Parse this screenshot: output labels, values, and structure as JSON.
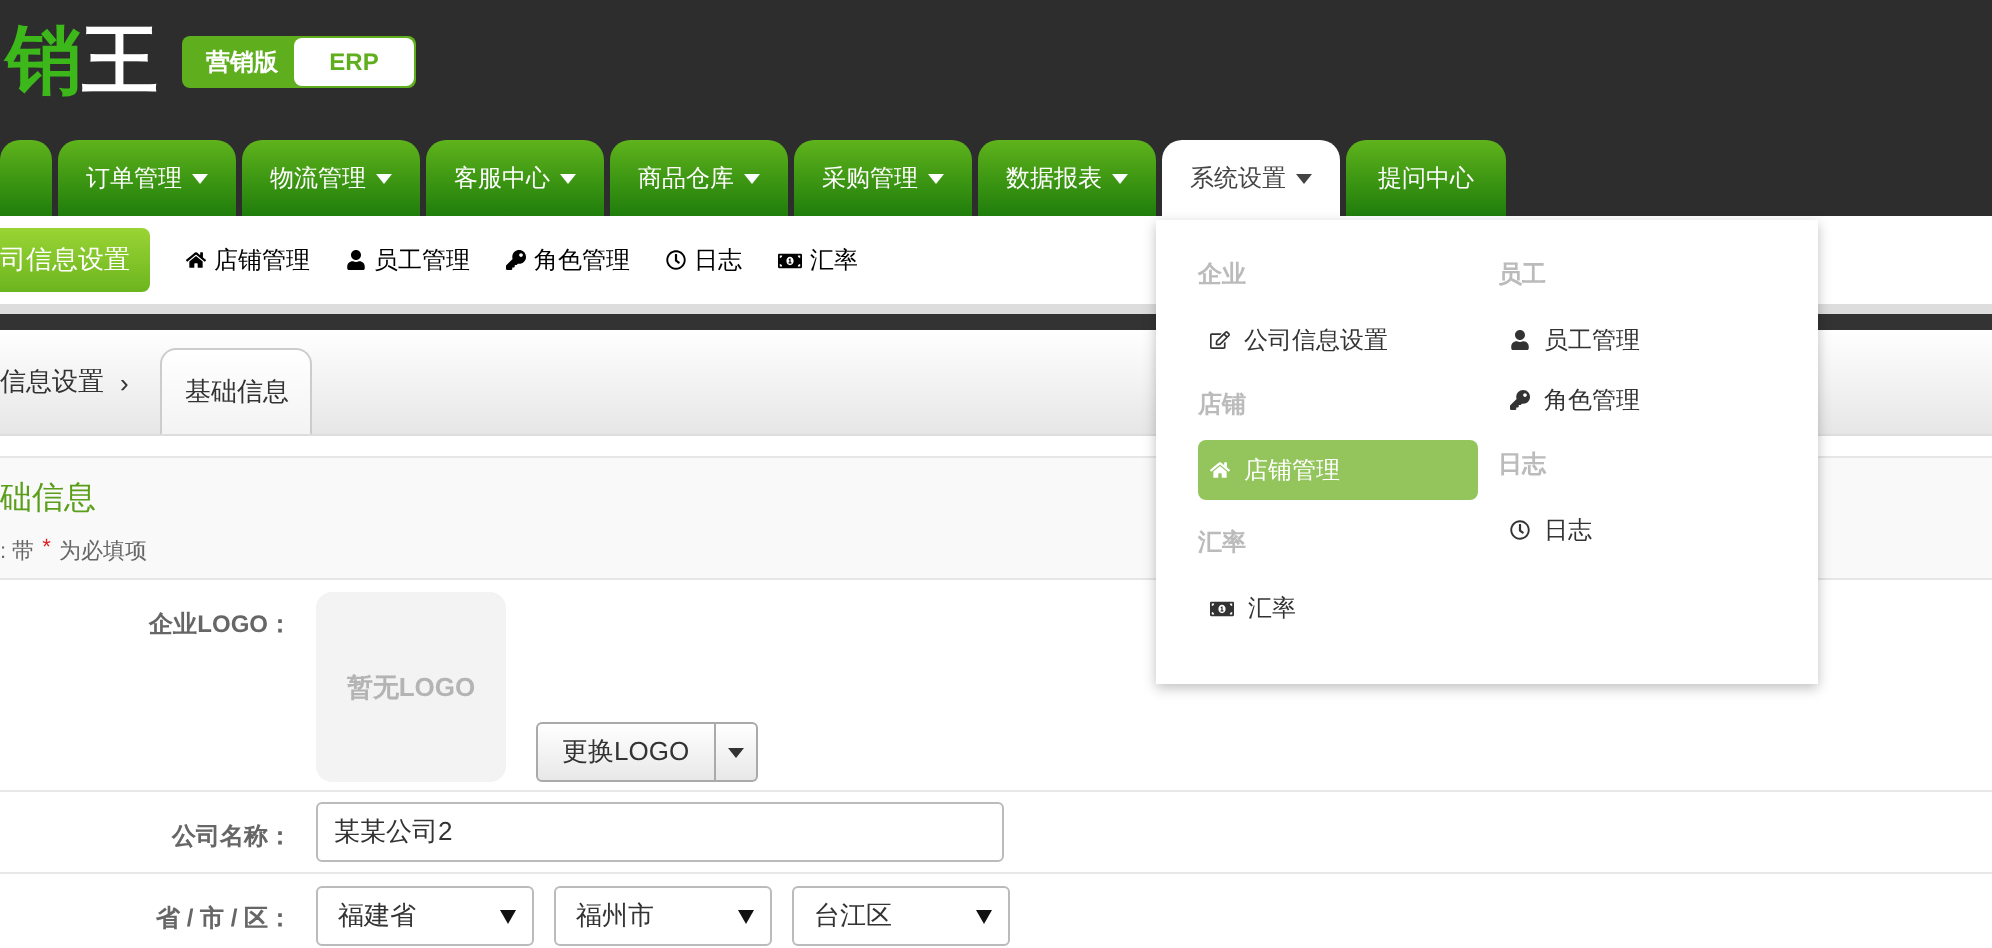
{
  "brand": {
    "accent": "销",
    "rest": "王",
    "edition": "营销版",
    "product": "ERP"
  },
  "nav_tabs": [
    {
      "has_caret": false,
      "selected": false
    },
    {
      "label": "订单管理",
      "has_caret": true,
      "selected": false
    },
    {
      "label": "物流管理",
      "has_caret": true,
      "selected": false
    },
    {
      "label": "客服中心",
      "has_caret": true,
      "selected": false
    },
    {
      "label": "商品仓库",
      "has_caret": true,
      "selected": false
    },
    {
      "label": "采购管理",
      "has_caret": true,
      "selected": false
    },
    {
      "label": "数据报表",
      "has_caret": true,
      "selected": false
    },
    {
      "label": "系统设置",
      "has_caret": true,
      "selected": true
    },
    {
      "label": "提问中心",
      "has_caret": false,
      "selected": false
    }
  ],
  "sub_nav": [
    {
      "label": "司信息设置",
      "kind": "plain",
      "selected": true
    },
    {
      "label": "店铺管理",
      "kind": "home",
      "selected": false
    },
    {
      "label": "员工管理",
      "kind": "user",
      "selected": false
    },
    {
      "label": "角色管理",
      "kind": "key",
      "selected": false
    },
    {
      "label": "日志",
      "kind": "clock",
      "selected": false
    },
    {
      "label": "汇率",
      "kind": "money",
      "selected": false
    }
  ],
  "breadcrumb": {
    "parent": "信息设置",
    "separator": "›",
    "tabs": [
      {
        "label": "基础信息",
        "selected": true
      }
    ]
  },
  "section": {
    "title": "础信息",
    "note_prefix": ": 带",
    "required_mark": "*",
    "note_suffix": "为必填项"
  },
  "form": {
    "logo_label": "企业LOGO：",
    "logo_placeholder": "暂无LOGO",
    "change_logo_button": "更换LOGO",
    "name_label": "公司名称：",
    "name_value": "某某公司2",
    "region_label": "省 / 市 / 区：",
    "region_selects": [
      "福建省",
      "福州市",
      "台江区"
    ]
  },
  "dropdown": {
    "columns": [
      [
        {
          "heading": "企业",
          "items": [
            {
              "label": "公司信息设置",
              "kind": "edit",
              "selected": false
            }
          ]
        },
        {
          "heading": "店铺",
          "items": [
            {
              "label": "店铺管理",
              "kind": "home",
              "selected": true
            }
          ]
        },
        {
          "heading": "汇率",
          "items": [
            {
              "label": "汇率",
              "kind": "money",
              "selected": false
            }
          ]
        }
      ],
      [
        {
          "heading": "员工",
          "items": [
            {
              "label": "员工管理",
              "kind": "user",
              "selected": false
            },
            {
              "label": "角色管理",
              "kind": "key",
              "selected": false
            }
          ]
        },
        {
          "heading": "日志",
          "items": [
            {
              "label": "日志",
              "kind": "clock",
              "selected": false
            }
          ]
        }
      ]
    ]
  }
}
